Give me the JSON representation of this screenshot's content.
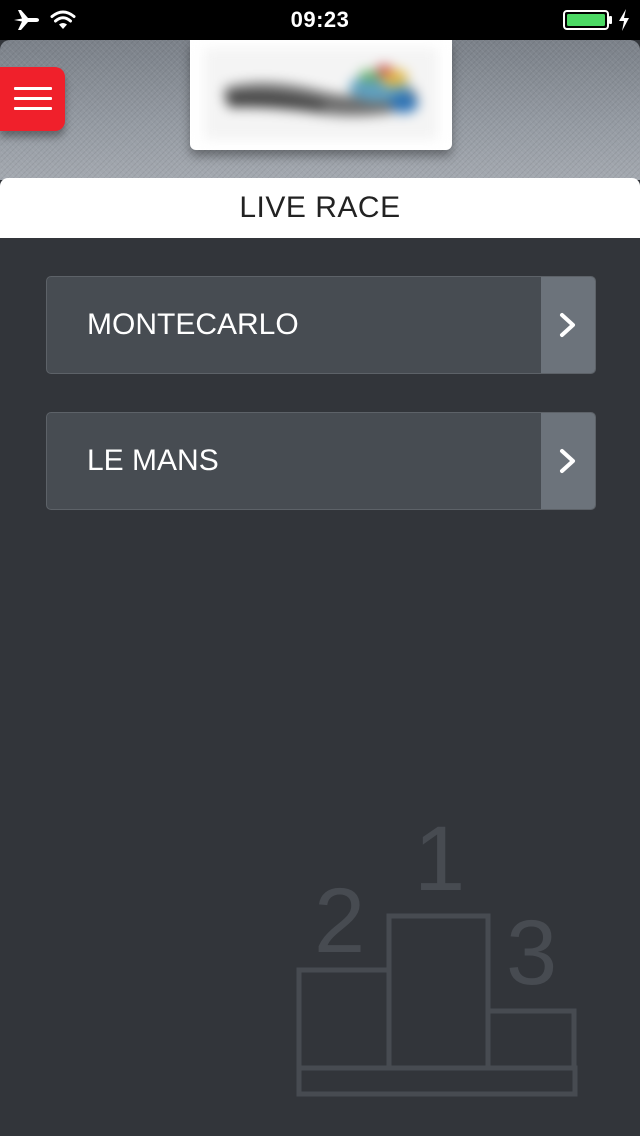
{
  "status_bar": {
    "time": "09:23",
    "icons": [
      "airplane-mode-icon",
      "wifi-icon",
      "battery-icon",
      "charging-icon"
    ],
    "battery_color": "#4cd964"
  },
  "header": {
    "menu_icon": "hamburger-menu-icon",
    "menu_color": "#f0202b",
    "logo": "blurred-logo-image"
  },
  "page": {
    "title": "LIVE RACE"
  },
  "races": [
    {
      "label": "MONTECARLO",
      "icon": "chevron-right-icon"
    },
    {
      "label": "LE MANS",
      "icon": "chevron-right-icon"
    }
  ],
  "podium": {
    "icon": "podium-icon",
    "places": [
      "1",
      "2",
      "3"
    ]
  }
}
